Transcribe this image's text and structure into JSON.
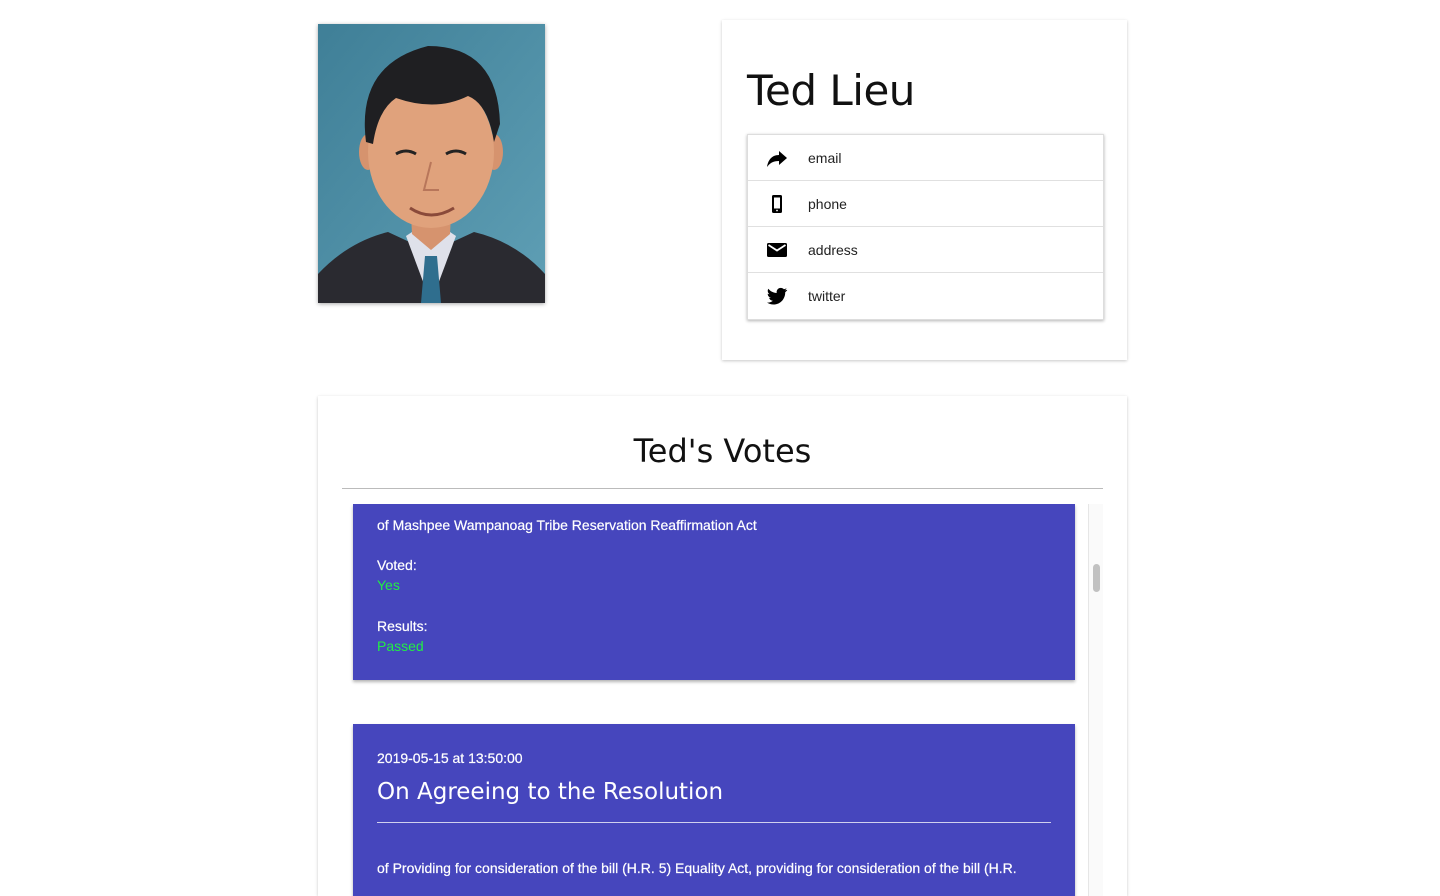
{
  "member": {
    "name": "Ted Lieu",
    "photo_alt": "Ted Lieu"
  },
  "contacts": [
    {
      "label": "email",
      "icon": "share-arrow-icon"
    },
    {
      "label": "phone",
      "icon": "smartphone-icon"
    },
    {
      "label": "address",
      "icon": "envelope-icon"
    },
    {
      "label": "twitter",
      "icon": "twitter-bird-icon"
    }
  ],
  "votes": {
    "title": "Ted's Votes",
    "items": [
      {
        "description": "of Mashpee Wampanoag Tribe Reservation Reaffirmation Act",
        "voted_label": "Voted:",
        "voted_value": "Yes",
        "results_label": "Results:",
        "results_value": "Passed"
      },
      {
        "date": "2019-05-15 at 13:50:00",
        "question": "On Agreeing to the Resolution",
        "description": "of Providing for consideration of the bill (H.R. 5) Equality Act, providing for consideration of the bill (H.R."
      }
    ]
  },
  "colors": {
    "vote_card_bg": "#4646bd",
    "status_green": "#22ee44"
  }
}
